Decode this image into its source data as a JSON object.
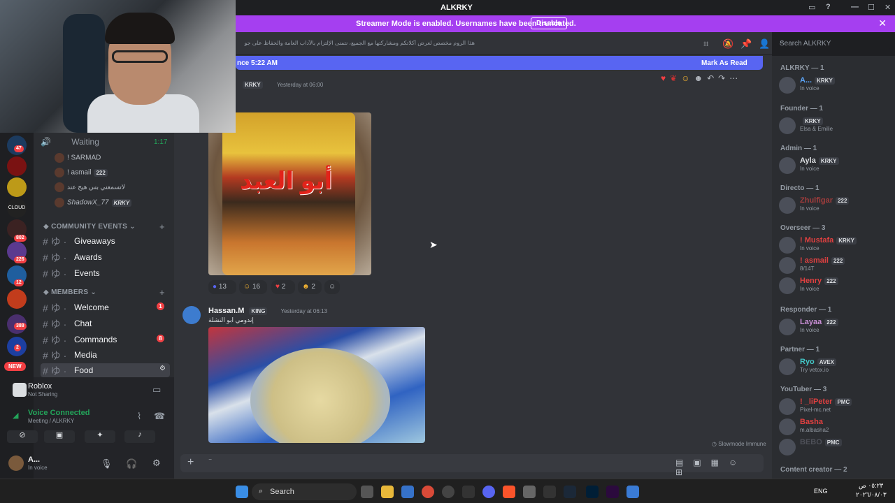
{
  "window": {
    "title": "ALKRKY"
  },
  "banner": {
    "message": "Streamer Mode is enabled. Usernames have been truncated.",
    "button": "Disable"
  },
  "channel_topic": "هذا الروم مخصص لعرض أكلاتكم ومشاركتها مع الجميع، نتمنى الإلتزام بالآداب العامة والحفاظ على جودة المحتوى.",
  "search": {
    "placeholder": "Search ALKRKY"
  },
  "new_messages": {
    "text": "nce 5:22 AM",
    "mark": "Mark As Read"
  },
  "servers": [
    {
      "badge": "47"
    },
    {
      "badge": ""
    },
    {
      "badge": ""
    },
    {
      "badge": ""
    },
    {
      "badge": "802"
    },
    {
      "badge": "226"
    },
    {
      "badge": "12"
    },
    {
      "badge": ""
    },
    {
      "badge": "388"
    },
    {
      "badge": "2"
    }
  ],
  "new_pill": "NEW",
  "voice_channel": {
    "name": "Waiting",
    "timer": "1:17",
    "users": [
      {
        "name": "! SARMAD",
        "tag": ""
      },
      {
        "name": "! asmail",
        "tag": "222"
      },
      {
        "name": "لاتسمعني بس هيج عند",
        "tag": ""
      },
      {
        "name": "ShadowX_77",
        "tag": "KRKY"
      }
    ]
  },
  "categories": {
    "community": "COMMUNITY EVENTS",
    "members": "MEMBERS"
  },
  "channels": [
    {
      "label": "Giveaways",
      "badge": ""
    },
    {
      "label": "Awards",
      "badge": ""
    },
    {
      "label": "Events",
      "badge": ""
    },
    {
      "label": "Welcome",
      "badge": "1"
    },
    {
      "label": "Chat",
      "badge": ""
    },
    {
      "label": "Commands",
      "badge": "8"
    },
    {
      "label": "Media",
      "badge": ""
    },
    {
      "label": "Food",
      "badge": ""
    }
  ],
  "activity": {
    "game": "Roblox",
    "status": "Not Sharing"
  },
  "voice": {
    "status": "Voice Connected",
    "location": "Meeting / ALKRKY"
  },
  "user": {
    "name": "A...",
    "status": "In voice"
  },
  "messages": [
    {
      "tag": "KRKY",
      "time": "Yesterday at 06:00",
      "image_text": "أبو العبد",
      "reactions": [
        {
          "count": "13"
        },
        {
          "count": "16"
        },
        {
          "count": "2"
        },
        {
          "count": "2"
        }
      ]
    },
    {
      "author": "Hassan.M",
      "tag": "KING",
      "time": "Yesterday at 06:13",
      "text": "إندومي ابو النشلة"
    }
  ],
  "slowmode": "Slowmode Immune",
  "members": {
    "roles": [
      {
        "name": "ALKRKY — 1",
        "list": [
          {
            "name": "A...",
            "tag": "KRKY",
            "status": "In voice",
            "color": "#5ba3f5"
          }
        ]
      },
      {
        "name": "Founder — 1",
        "list": [
          {
            "name": "",
            "tag": "KRKY",
            "status": "Elsa & Emilie",
            "color": "#a0a4ab"
          }
        ]
      },
      {
        "name": "Admin — 1",
        "list": [
          {
            "name": "Ayla",
            "tag": "KRKY",
            "status": "In voice",
            "color": "#dbdee1"
          }
        ]
      },
      {
        "name": "Directo — 1",
        "list": [
          {
            "name": "Zhulfigar",
            "tag": "222",
            "status": "In voice",
            "color": "#a13c3c"
          }
        ]
      },
      {
        "name": "Overseer — 3",
        "list": [
          {
            "name": "! Mustafa",
            "tag": "KRKY",
            "status": "In voice",
            "color": "#e04040"
          },
          {
            "name": "! asmail",
            "tag": "222",
            "status": "8/14T",
            "color": "#e04040"
          },
          {
            "name": "Henry",
            "tag": "222",
            "status": "In voice",
            "color": "#e04040"
          }
        ]
      },
      {
        "name": "Responder — 1",
        "list": [
          {
            "name": "Layaa",
            "tag": "222",
            "status": "In voice",
            "color": "#c98fd6"
          }
        ]
      },
      {
        "name": "Partner — 1",
        "list": [
          {
            "name": "Ryo",
            "tag": "AVEX",
            "status": "Try vetox.io",
            "color": "#43c6c6"
          }
        ]
      },
      {
        "name": "YouTuber — 3",
        "list": [
          {
            "name": "! _liPeter",
            "tag": "PMC",
            "status": "Pixel-mc.net",
            "color": "#e04040"
          },
          {
            "name": "Basha",
            "tag": "",
            "status": "m.albasha2",
            "color": "#e04040"
          },
          {
            "name": "BEBO",
            "tag": "PMC",
            "status": "",
            "color": "#4e5058"
          }
        ]
      },
      {
        "name": "Content creator — 2",
        "list": []
      }
    ]
  },
  "taskbar": {
    "search": "Search",
    "lang": "ENG",
    "time": "٠٥:٢٣ ص",
    "date": "٢٠٢٦/٠٨/٠٣"
  }
}
